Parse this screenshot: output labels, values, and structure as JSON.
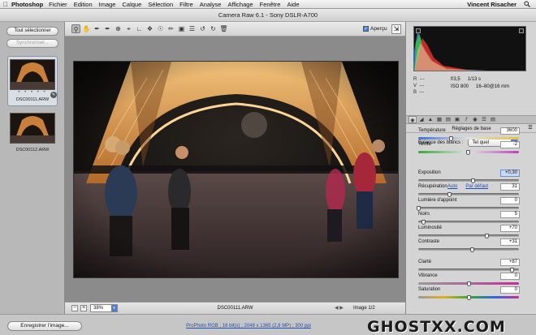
{
  "menubar": {
    "app_name": "Photoshop",
    "items": [
      "Fichier",
      "Edition",
      "Image",
      "Calque",
      "Sélection",
      "Filtre",
      "Analyse",
      "Affichage",
      "Fenêtre",
      "Aide"
    ],
    "user": "Vincent Risacher"
  },
  "window": {
    "title": "Camera Raw 6.1  -  Sony DSLR-A700"
  },
  "filmstrip": {
    "select_all": "Tout sélectionner",
    "synchronize": "Synchroniser...",
    "rating_dots": "• • • • •",
    "items": [
      {
        "name": "DSC00111.ARW",
        "selected": true
      },
      {
        "name": "DSC00112.ARW",
        "selected": false
      }
    ]
  },
  "toolbar": {
    "tools": [
      "zoom-icon",
      "hand-icon",
      "white-balance-icon",
      "color-sampler-icon",
      "target-adjust-icon",
      "crop-icon",
      "straighten-icon",
      "spot-removal-icon",
      "red-eye-icon",
      "adjustment-brush-icon",
      "graduated-filter-icon",
      "preferences-icon",
      "rotate-ccw-icon",
      "rotate-cw-icon",
      "trash-icon"
    ],
    "preview_label": "Aperçu",
    "preview_checked": true
  },
  "status": {
    "zoom": "38%",
    "filename": "DSC00111.ARW",
    "image_count": "Image 1/2"
  },
  "info": {
    "rgb_labels": [
      "R",
      "V",
      "B"
    ],
    "rgb_values": [
      "---",
      "---",
      "---"
    ],
    "aperture": "f/3,5",
    "shutter": "1/13 s",
    "iso": "ISO 800",
    "focal": "16–80@16 mm"
  },
  "panel": {
    "tabs": [
      "aperture-icon",
      "tone-curve-icon",
      "detail-icon",
      "hsl-icon",
      "split-tone-icon",
      "lens-icon",
      "fx-icon",
      "camera-calibration-icon",
      "presets-icon",
      "snapshots-icon"
    ],
    "section_title": "Réglages de base",
    "white_balance_label": "Balance des blancs :",
    "white_balance_value": "Tel quel",
    "auto_label": "Auto",
    "default_label": "Par défaut",
    "sliders": [
      {
        "label": "Température",
        "value": "3600",
        "position": 0.32,
        "kind": "temp"
      },
      {
        "label": "Teinte",
        "value": "-2",
        "position": 0.49,
        "kind": "tint"
      },
      {
        "label": "Exposition",
        "value": "+0,30",
        "position": 0.54,
        "kind": "plain",
        "highlight": true
      },
      {
        "label": "Récupération",
        "value": "31",
        "position": 0.31,
        "kind": "plain"
      },
      {
        "label": "Lumière d'appoint",
        "value": "0",
        "position": 0.0,
        "kind": "plain"
      },
      {
        "label": "Noirs",
        "value": "5",
        "position": 0.05,
        "kind": "plain"
      },
      {
        "label": "Luminosité",
        "value": "+70",
        "position": 0.68,
        "kind": "plain"
      },
      {
        "label": "Contraste",
        "value": "+31",
        "position": 0.53,
        "kind": "plain"
      },
      {
        "label": "Clarté",
        "value": "+87",
        "position": 0.93,
        "kind": "plain"
      },
      {
        "label": "Vibrance",
        "value": "0",
        "position": 0.5,
        "kind": "vibrance"
      },
      {
        "label": "Saturation",
        "value": "0",
        "position": 0.5,
        "kind": "saturation"
      }
    ]
  },
  "footer": {
    "save_label": "Enregistrer l'image...",
    "workflow_link": "ProPhoto RGB ; 16 bit(s) ; 2048 x 1365 (2,8 MP) ; 300 ppi",
    "watermark": "GHOSTXX.COM"
  }
}
